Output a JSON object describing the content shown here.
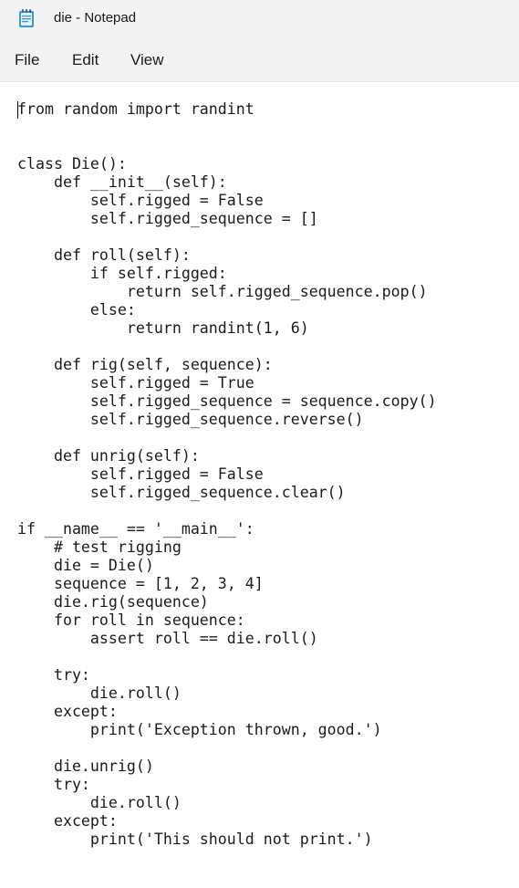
{
  "window": {
    "title": "die - Notepad",
    "app_icon": "notepad-icon"
  },
  "menubar": {
    "file_label": "File",
    "edit_label": "Edit",
    "view_label": "View"
  },
  "editor": {
    "content": "from random import randint\n\n\nclass Die():\n    def __init__(self):\n        self.rigged = False\n        self.rigged_sequence = []\n\n    def roll(self):\n        if self.rigged:\n            return self.rigged_sequence.pop()\n        else:\n            return randint(1, 6)\n\n    def rig(self, sequence):\n        self.rigged = True\n        self.rigged_sequence = sequence.copy()\n        self.rigged_sequence.reverse()\n\n    def unrig(self):\n        self.rigged = False\n        self.rigged_sequence.clear()\n\nif __name__ == '__main__':\n    # test rigging\n    die = Die()\n    sequence = [1, 2, 3, 4]\n    die.rig(sequence)\n    for roll in sequence:\n        assert roll == die.roll()\n\n    try:\n        die.roll()\n    except:\n        print('Exception thrown, good.')\n\n    die.unrig()\n    try:\n        die.roll()\n    except:\n        print('This should not print.')"
  }
}
